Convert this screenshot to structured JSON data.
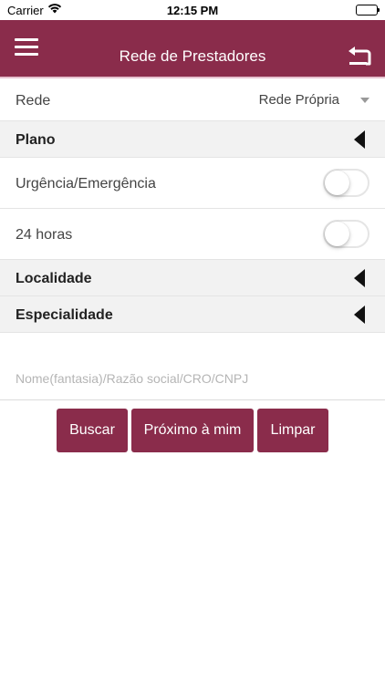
{
  "status_bar": {
    "carrier": "Carrier",
    "time": "12:15 PM"
  },
  "header": {
    "title": "Rede de Prestadores"
  },
  "form": {
    "rede": {
      "label": "Rede",
      "selected": "Rede Própria"
    },
    "plano": {
      "label": "Plano"
    },
    "urgencia": {
      "label": "Urgência/Emergência",
      "enabled": false
    },
    "horas24": {
      "label": "24 horas",
      "enabled": false
    },
    "localidade": {
      "label": "Localidade"
    },
    "especialidade": {
      "label": "Especialidade"
    },
    "search": {
      "placeholder": "Nome(fantasia)/Razão social/CRO/CNPJ",
      "value": ""
    }
  },
  "actions": {
    "buscar": "Buscar",
    "proximo": "Próximo à mim",
    "limpar": "Limpar"
  },
  "colors": {
    "brand": "#8a2c4b",
    "section_bg": "#f2f2f2"
  }
}
